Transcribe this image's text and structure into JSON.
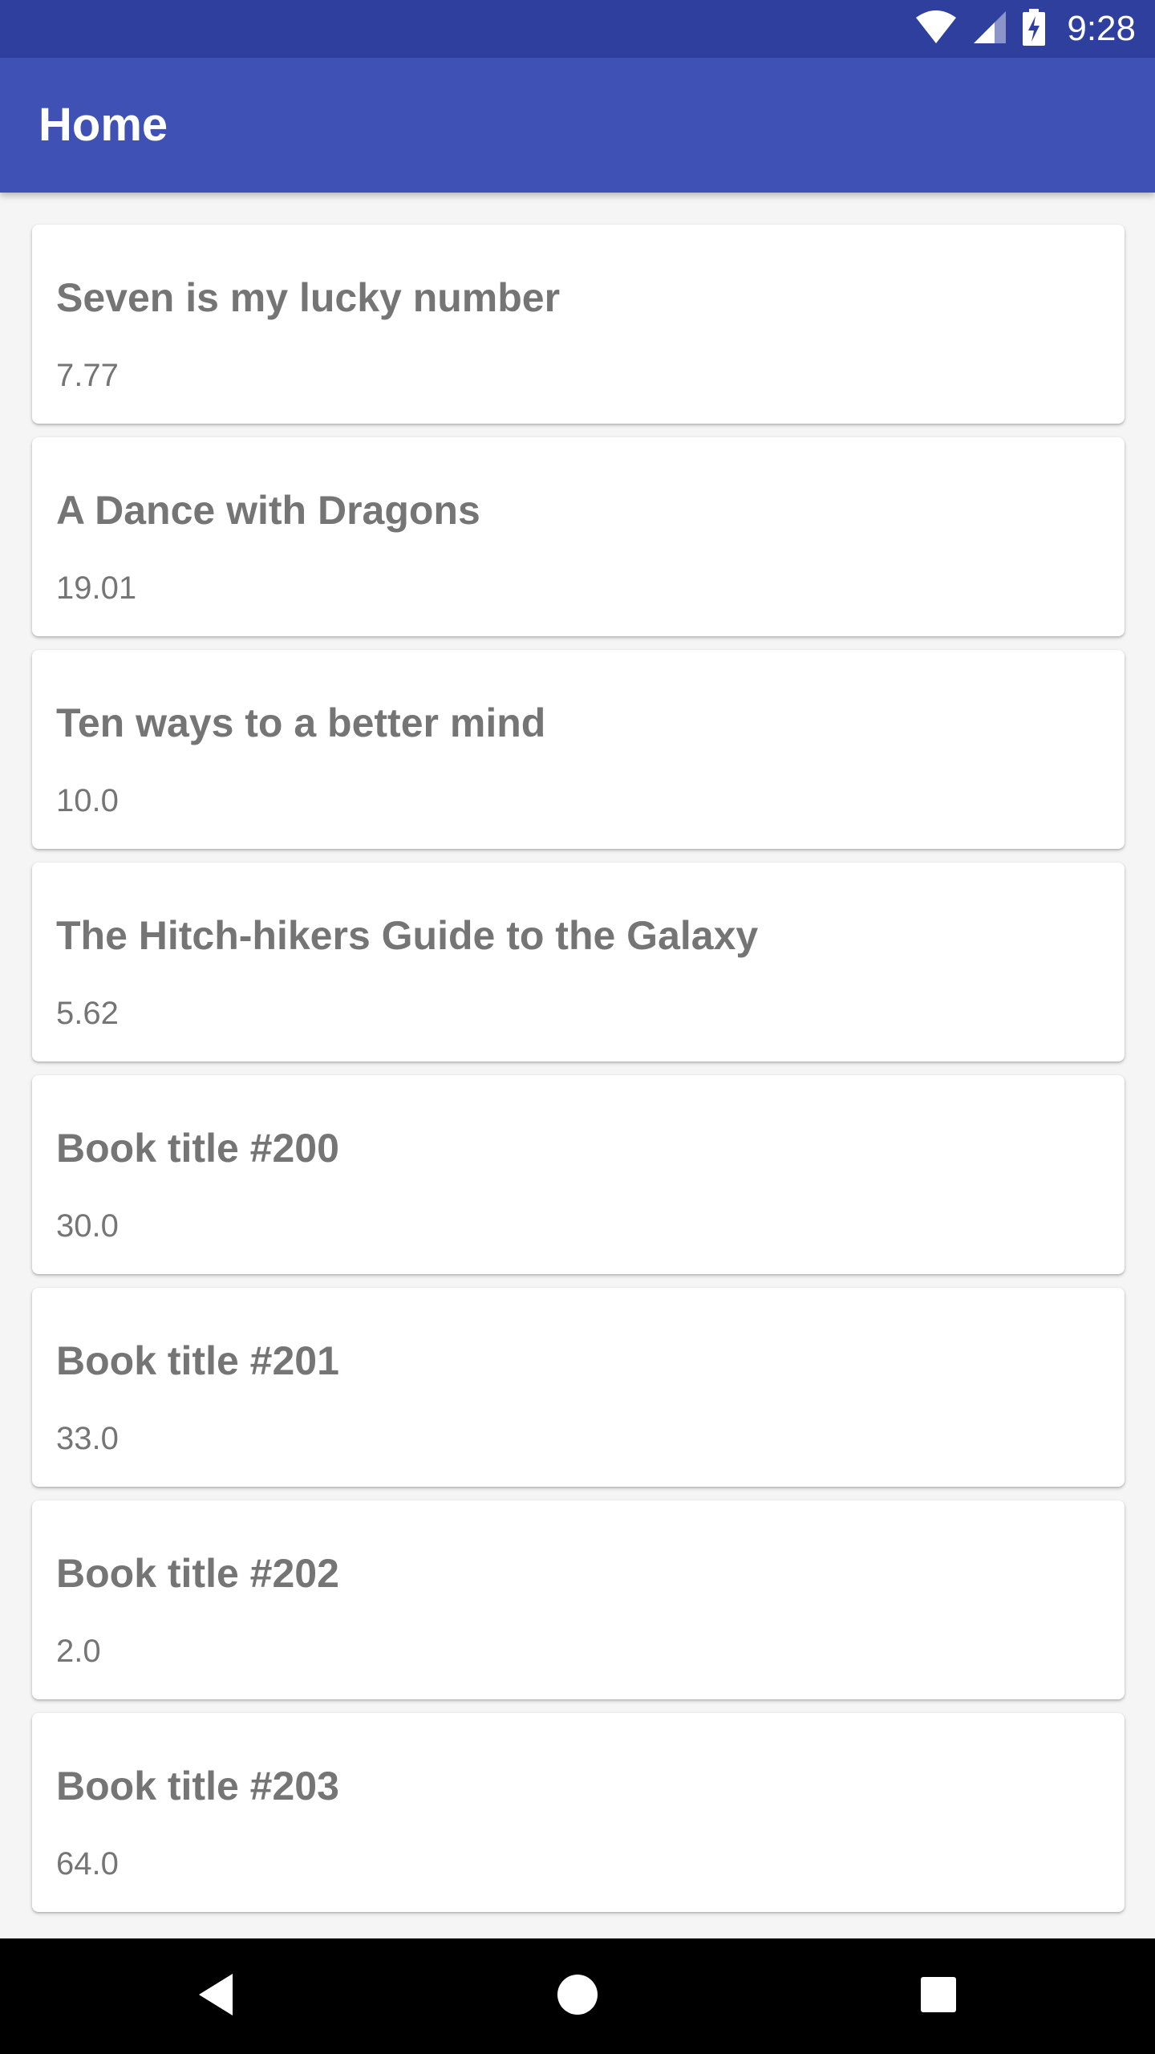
{
  "status_bar": {
    "time": "9:28",
    "icons": [
      "wifi-icon",
      "cell-signal-icon",
      "battery-charging-icon"
    ]
  },
  "app_bar": {
    "title": "Home",
    "color": "#3f51b5"
  },
  "books": [
    {
      "title": "Seven is my lucky number",
      "price": "7.77"
    },
    {
      "title": "A Dance with Dragons",
      "price": "19.01"
    },
    {
      "title": "Ten ways to a better mind",
      "price": "10.0"
    },
    {
      "title": "The Hitch-hikers Guide to the Galaxy",
      "price": "5.62"
    },
    {
      "title": "Book title #200",
      "price": "30.0"
    },
    {
      "title": "Book title #201",
      "price": "33.0"
    },
    {
      "title": "Book title #202",
      "price": "2.0"
    },
    {
      "title": "Book title #203",
      "price": "64.0"
    }
  ],
  "nav_bar": {
    "buttons": [
      "back-icon",
      "home-icon",
      "recents-icon"
    ]
  },
  "colors": {
    "status_bar": "#2f3f9e",
    "app_bar": "#3f51b5",
    "text": "#757575",
    "background": "#f5f5f5"
  }
}
